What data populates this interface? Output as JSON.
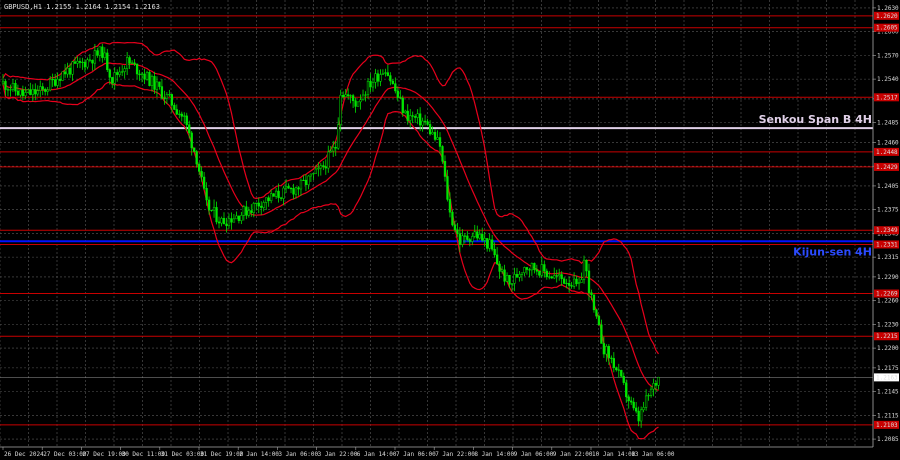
{
  "header": {
    "title": "GBPUSD,H1  1.2155 1.2164 1.2154 1.2163"
  },
  "colors": {
    "background": "#000000",
    "grid": "#5a5a5a",
    "bull": "#00e600",
    "bear": "#00e600",
    "band": "#e8001c",
    "level": "#c80000",
    "senkou": "#e0d0e8",
    "kijun": "#0010ff",
    "text": "#dddddd"
  },
  "chart_data": {
    "type": "candlestick",
    "ylim": [
      1.2075,
      1.264
    ],
    "y_ticks": [
      1.263,
      1.26,
      1.257,
      1.254,
      1.2515,
      1.2485,
      1.246,
      1.243,
      1.2405,
      1.2375,
      1.2345,
      1.2315,
      1.229,
      1.226,
      1.223,
      1.22,
      1.2175,
      1.2145,
      1.2115,
      1.2085
    ],
    "x_labels": [
      "26 Dec 2024",
      "27 Dec 03:00",
      "27 Dec 19:00",
      "30 Dec 11:00",
      "31 Dec 03:00",
      "31 Dec 19:00",
      "2 Jan 14:00",
      "3 Jan 06:00",
      "3 Jan 22:00",
      "6 Jan 14:00",
      "7 Jan 06:00",
      "7 Jan 22:00",
      "8 Jan 14:00",
      "9 Jan 06:00",
      "9 Jan 22:00",
      "10 Jan 14:00",
      "13 Jan 06:00"
    ],
    "current_price": 1.2163,
    "levels": [
      {
        "value": 1.262,
        "label": "1.2620"
      },
      {
        "value": 1.2605,
        "label": "1.2605"
      },
      {
        "value": 1.2517,
        "label": "1.2517"
      },
      {
        "value": 1.2448,
        "label": "1.2448"
      },
      {
        "value": 1.2429,
        "label": "1.2429"
      },
      {
        "value": 1.2349,
        "label": "1.2349"
      },
      {
        "value": 1.2331,
        "label": "1.2331"
      },
      {
        "value": 1.2269,
        "label": "1.2269"
      },
      {
        "value": 1.2215,
        "label": "1.2215"
      },
      {
        "value": 1.2103,
        "label": "1.2103"
      }
    ],
    "senkou_span_b": {
      "value": 1.2478,
      "label": "Senkou Span B 4H"
    },
    "kijun_sen": {
      "value": 1.2335,
      "label": "Kijun-sen 4H"
    },
    "price_anchors": [
      [
        0,
        1.2535
      ],
      [
        8,
        1.252
      ],
      [
        16,
        1.2525
      ],
      [
        24,
        1.2548
      ],
      [
        32,
        1.256
      ],
      [
        40,
        1.2575
      ],
      [
        44,
        1.254
      ],
      [
        50,
        1.2562
      ],
      [
        56,
        1.2548
      ],
      [
        62,
        1.253
      ],
      [
        68,
        1.251
      ],
      [
        73,
        1.249
      ],
      [
        78,
        1.244
      ],
      [
        82,
        1.238
      ],
      [
        88,
        1.236
      ],
      [
        96,
        1.237
      ],
      [
        104,
        1.2385
      ],
      [
        112,
        1.2395
      ],
      [
        120,
        1.2405
      ],
      [
        128,
        1.2425
      ],
      [
        134,
        1.2455
      ],
      [
        136,
        1.2525
      ],
      [
        142,
        1.251
      ],
      [
        148,
        1.2535
      ],
      [
        154,
        1.2555
      ],
      [
        158,
        1.2525
      ],
      [
        162,
        1.2495
      ],
      [
        170,
        1.2485
      ],
      [
        176,
        1.2455
      ],
      [
        180,
        1.237
      ],
      [
        184,
        1.2335
      ],
      [
        190,
        1.2345
      ],
      [
        196,
        1.233
      ],
      [
        200,
        1.23
      ],
      [
        204,
        1.228
      ],
      [
        210,
        1.2305
      ],
      [
        216,
        1.23
      ],
      [
        222,
        1.229
      ],
      [
        228,
        1.2285
      ],
      [
        232,
        1.2275
      ],
      [
        234,
        1.231
      ],
      [
        238,
        1.2245
      ],
      [
        242,
        1.22
      ],
      [
        246,
        1.218
      ],
      [
        250,
        1.215
      ],
      [
        254,
        1.212
      ],
      [
        256,
        1.211
      ],
      [
        260,
        1.214
      ],
      [
        264,
        1.2163
      ]
    ]
  }
}
